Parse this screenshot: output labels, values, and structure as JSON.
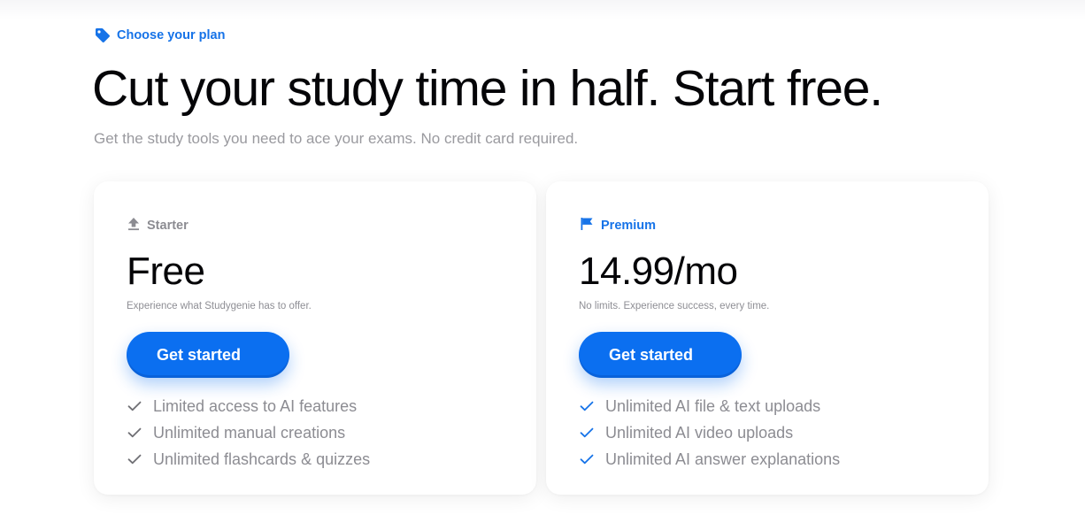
{
  "header": {
    "eyebrow": "Choose your plan",
    "eyebrow_icon": "tag-icon",
    "title": "Cut your study time in half. Start free.",
    "subtitle": "Get the study tools you need to ace your exams. No credit card required."
  },
  "plans": [
    {
      "tier": "Starter",
      "tier_icon": "upload-icon",
      "price": "Free",
      "description": "Experience what Studygenie has to offer.",
      "cta": "Get started",
      "check_color": "#6f6f74",
      "features": [
        "Limited access to AI features",
        "Unlimited manual creations",
        "Unlimited flashcards & quizzes"
      ]
    },
    {
      "tier": "Premium",
      "tier_icon": "flag-icon",
      "price": "14.99/mo",
      "description": "No limits. Experience success, every time.",
      "cta": "Get started",
      "check_color": "#1673e8",
      "features": [
        "Unlimited AI file & text uploads",
        "Unlimited AI video uploads",
        "Unlimited AI answer explanations"
      ]
    }
  ],
  "colors": {
    "accent": "#1673e8",
    "button": "#0b6ff0",
    "muted_text": "#8c8c92"
  }
}
